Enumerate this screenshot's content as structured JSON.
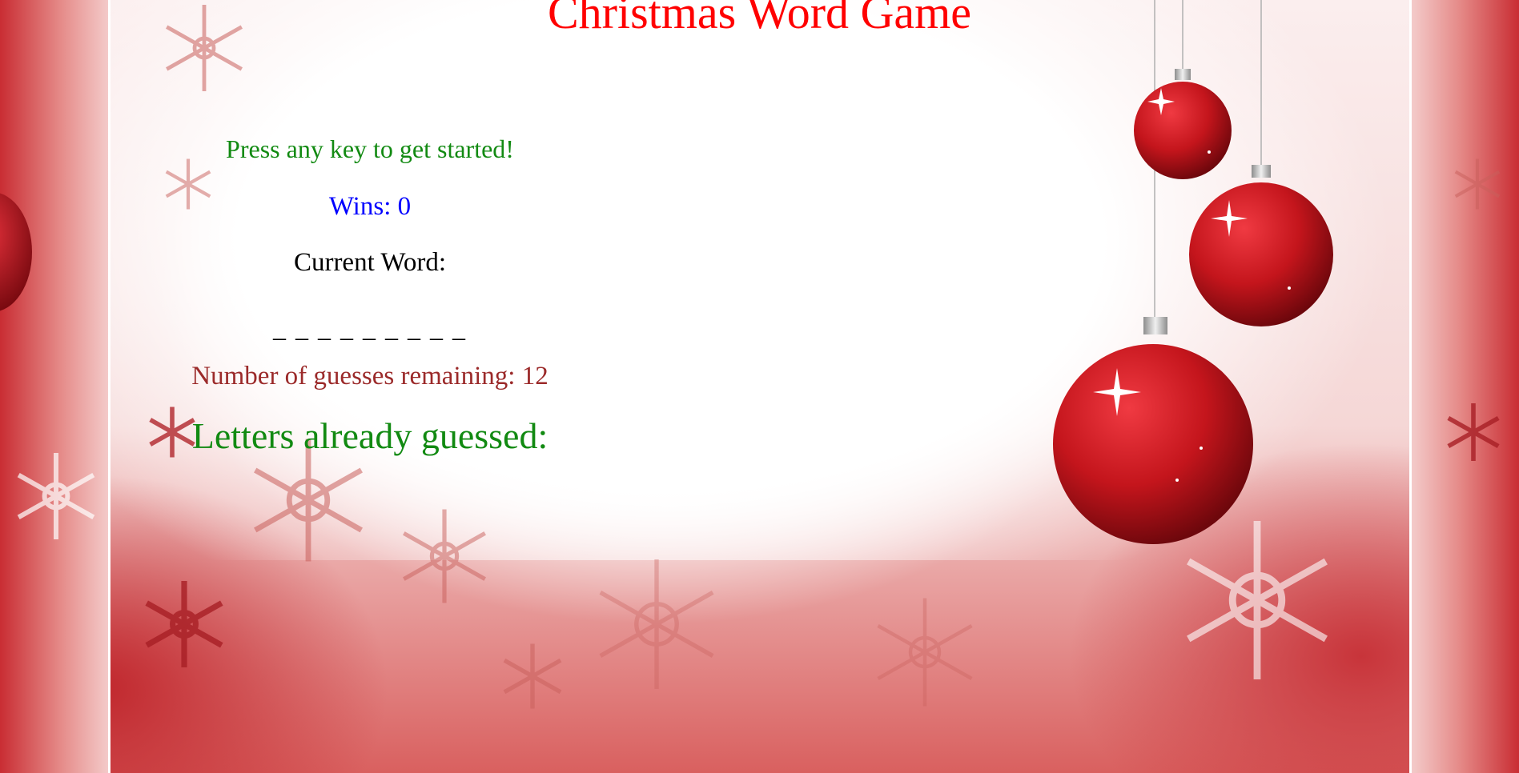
{
  "page": {
    "title": "Christmas Word Game"
  },
  "game": {
    "prompt": "Press any key to get started!",
    "wins_label": "Wins: 0",
    "current_word_label": "Current Word:",
    "word_blanks": "_ _ _ _ _ _ _ _ _",
    "guesses_remaining_label": "Number of guesses remaining: 12",
    "letters_guessed_label": "Letters already guessed:"
  },
  "theme": {
    "title_color": "#ff0000",
    "prompt_color": "#128a12",
    "wins_color": "#0000ff",
    "guesses_color": "#9b2a2a",
    "ornament_color": "#c4151c"
  },
  "decor": {
    "background": "christmas-snowflake-border",
    "ornaments": [
      "red-bauble-icon",
      "red-bauble-icon",
      "red-bauble-icon"
    ]
  }
}
